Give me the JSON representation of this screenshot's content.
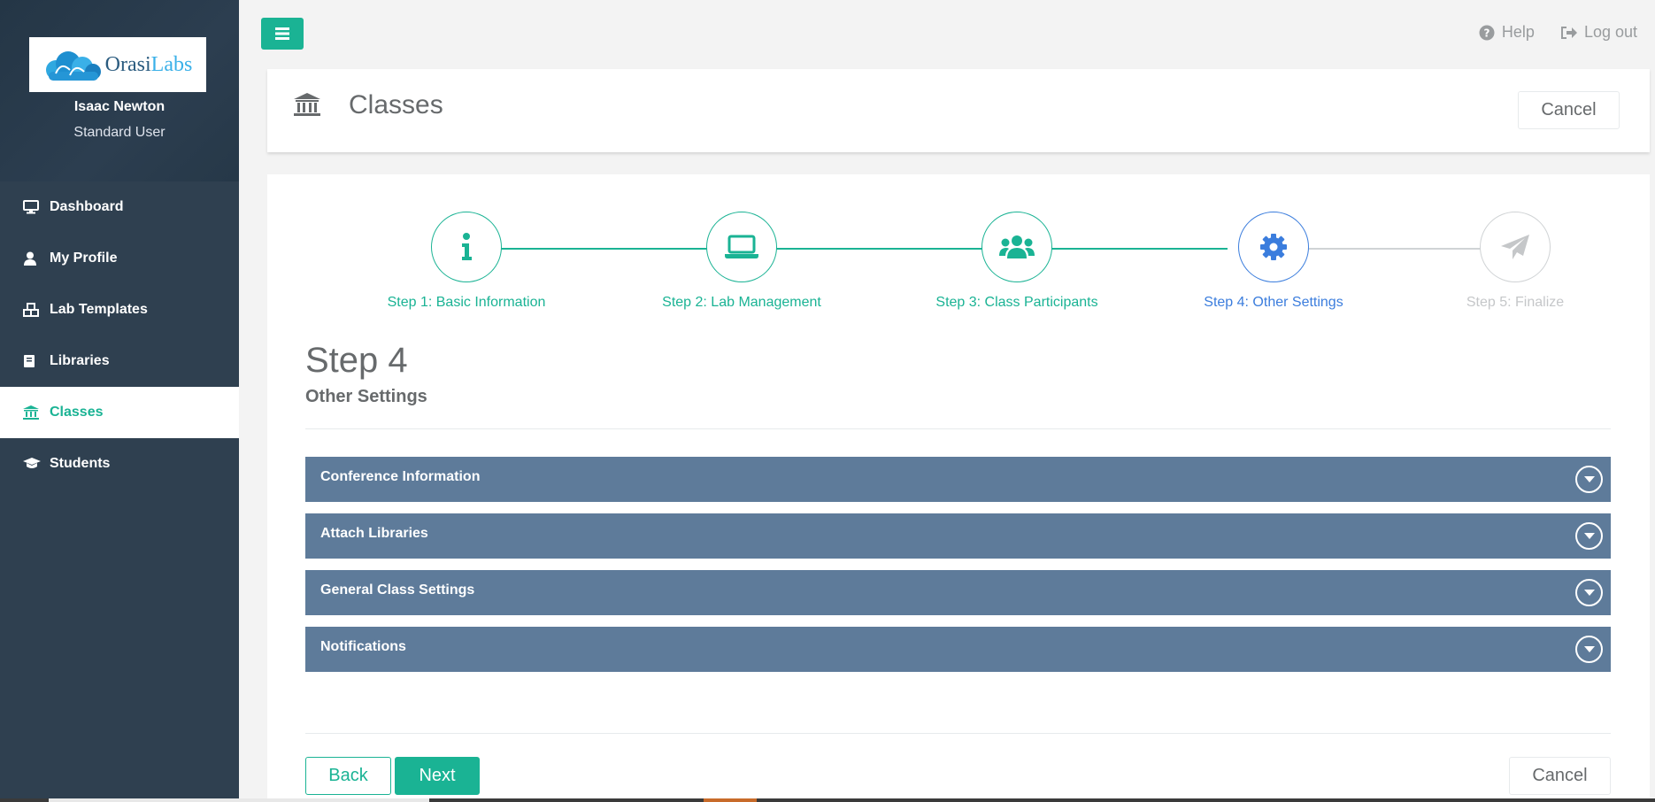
{
  "colors": {
    "accent": "#1ab394",
    "sidebar": "#2f4050",
    "active_step": "#3b7ddd",
    "inactive": "#c5c7c9",
    "accordion": "#5e7b9a"
  },
  "sidebar": {
    "logo": {
      "part1": "Orasi",
      "part2": "Labs"
    },
    "user_name": "Isaac Newton",
    "user_role": "Standard User",
    "items": [
      {
        "label": "Dashboard",
        "icon": "desktop-icon",
        "active": false
      },
      {
        "label": "My Profile",
        "icon": "user-icon",
        "active": false
      },
      {
        "label": "Lab Templates",
        "icon": "cubes-icon",
        "active": false
      },
      {
        "label": "Libraries",
        "icon": "book-icon",
        "active": false
      },
      {
        "label": "Classes",
        "icon": "institution-icon",
        "active": true
      },
      {
        "label": "Students",
        "icon": "graduation-cap-icon",
        "active": false
      }
    ]
  },
  "topbar": {
    "help_label": "Help",
    "logout_label": "Log out"
  },
  "header": {
    "title": "Classes",
    "cancel_label": "Cancel"
  },
  "stepper": {
    "steps": [
      {
        "label": "Step 1: Basic Information",
        "icon": "info-icon",
        "state": "done"
      },
      {
        "label": "Step 2: Lab Management",
        "icon": "laptop-icon",
        "state": "done"
      },
      {
        "label": "Step 3: Class Participants",
        "icon": "users-icon",
        "state": "done"
      },
      {
        "label": "Step 4: Other Settings",
        "icon": "gear-icon",
        "state": "current"
      },
      {
        "label": "Step 5: Finalize",
        "icon": "paper-plane-icon",
        "state": "pending"
      }
    ]
  },
  "form": {
    "heading": "Step 4",
    "subheading": "Other Settings",
    "sections": [
      "Conference Information",
      "Attach Libraries",
      "General Class Settings",
      "Notifications"
    ],
    "back_label": "Back",
    "next_label": "Next",
    "cancel_label": "Cancel"
  }
}
